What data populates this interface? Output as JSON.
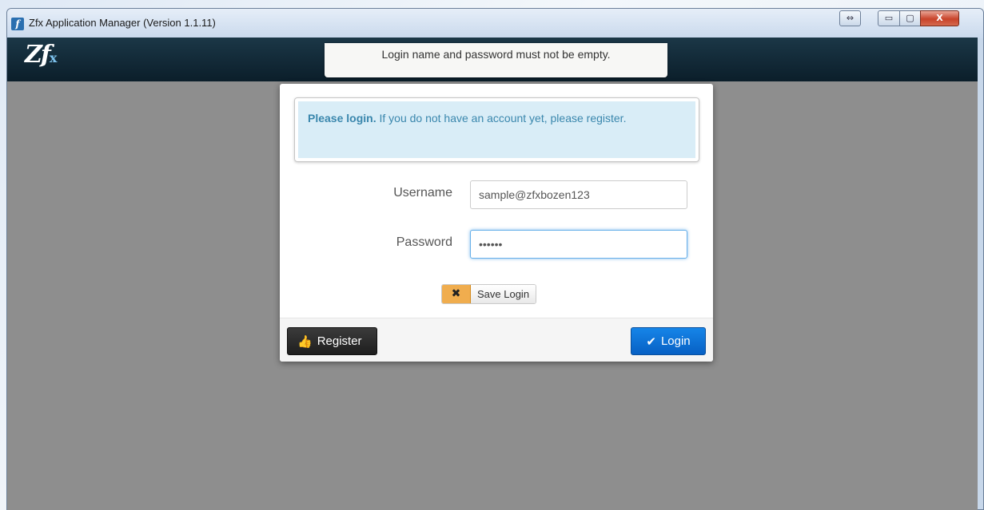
{
  "window": {
    "title": "Zfx Application Manager (Version 1.1.11)",
    "app_icon_glyph": "f",
    "controls": {
      "resize_glyph": "⇔",
      "minimize_glyph": "▭",
      "maximize_glyph": "▢",
      "close_glyph": "X"
    }
  },
  "header": {
    "logo_text": "Zf",
    "logo_sub": "x"
  },
  "toast": {
    "message": "Login name and password must not be empty."
  },
  "login": {
    "info_bold": "Please login.",
    "info_text": " If you do not have an account yet, please register.",
    "username_label": "Username",
    "username_value": "sample@zfxbozen123",
    "password_label": "Password",
    "password_value": "••••••",
    "save_login_icon": "✖",
    "save_login_label": "Save Login",
    "register_icon": "👍",
    "register_label": "Register",
    "login_icon": "✔",
    "login_label": "Login"
  },
  "colors": {
    "header_bg": "#0b1e2a",
    "body_bg": "#8e8e8e",
    "info_bg": "#d9edf7",
    "info_text": "#3a87ad",
    "login_button": "#0760c4",
    "register_button": "#1e1e1e",
    "save_toggle": "#f0ad4e"
  }
}
